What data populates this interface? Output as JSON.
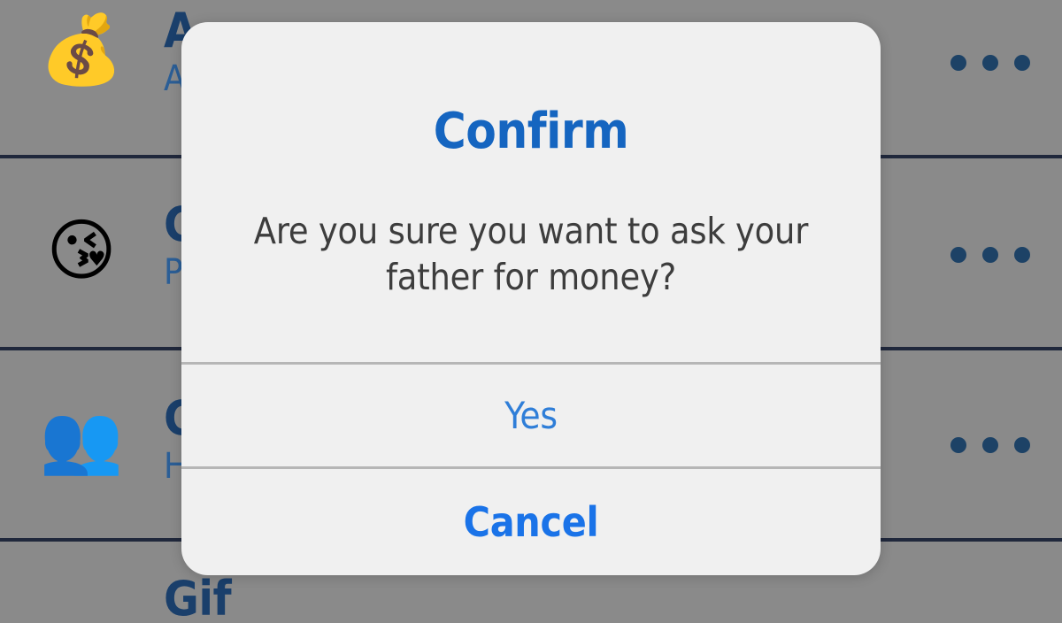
{
  "background": {
    "surface_color": "#8a8a8a",
    "separator_color": "#20283c",
    "title_color": "#1a3f6b",
    "subtitle_color": "#2b5e96",
    "menu_icon_name": "more-options-icon",
    "rows": [
      {
        "emoji": "💰",
        "emoji_name": "money-bag-emoji",
        "title": "A",
        "subtitle": "A",
        "menu": "•••"
      },
      {
        "emoji": "😘",
        "emoji_name": "face-blowing-a-kiss-emoji",
        "title": "C",
        "subtitle": "P",
        "menu": "•••"
      },
      {
        "emoji": "👥",
        "emoji_name": "busts-in-silhouette-emoji",
        "title": "C",
        "subtitle": "H",
        "menu": "•••"
      },
      {
        "emoji": "",
        "emoji_name": "partial-emoji",
        "title": "Gif",
        "subtitle": "",
        "menu": ""
      }
    ]
  },
  "dialog": {
    "title": "Confirm",
    "title_color": "#1565c0",
    "message": "Are you sure you want to ask your father for money?",
    "message_color": "#3d3d3d",
    "surface_color": "#f0f0f0",
    "divider_color": "#b6b6b6",
    "buttons": {
      "confirm_label": "Yes",
      "confirm_color": "#2f7ed8",
      "cancel_label": "Cancel",
      "cancel_color": "#1a73e8"
    }
  }
}
